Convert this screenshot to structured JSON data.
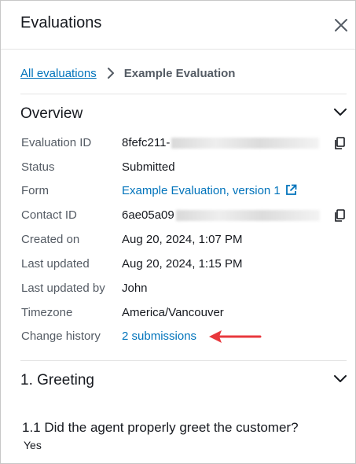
{
  "header": {
    "title": "Evaluations"
  },
  "breadcrumb": {
    "link": "All evaluations",
    "current": "Example Evaluation"
  },
  "overview": {
    "title": "Overview",
    "rows": [
      {
        "label": "Evaluation ID",
        "value": "8fefc211-"
      },
      {
        "label": "Status",
        "value": "Submitted"
      },
      {
        "label": "Form",
        "value": "Example Evaluation, version 1"
      },
      {
        "label": "Contact ID",
        "value": "6ae05a09"
      },
      {
        "label": "Created on",
        "value": "Aug 20, 2024, 1:07 PM"
      },
      {
        "label": "Last updated",
        "value": "Aug 20, 2024, 1:15 PM"
      },
      {
        "label": "Last updated by",
        "value": "John"
      },
      {
        "label": "Timezone",
        "value": "America/Vancouver"
      },
      {
        "label": "Change history",
        "value": "2 submissions"
      }
    ]
  },
  "greeting": {
    "title": "1. Greeting",
    "question": "1.1 Did the agent properly greet the customer?",
    "answer": "Yes"
  },
  "colors": {
    "link": "#0073bb",
    "annotation_arrow": "#e8383d",
    "text": "#16191f",
    "label": "#545b64"
  },
  "icons": [
    "close-icon",
    "chevron-right-icon",
    "chevron-down-icon",
    "copy-icon",
    "external-link-icon",
    "arrow-annotation"
  ]
}
